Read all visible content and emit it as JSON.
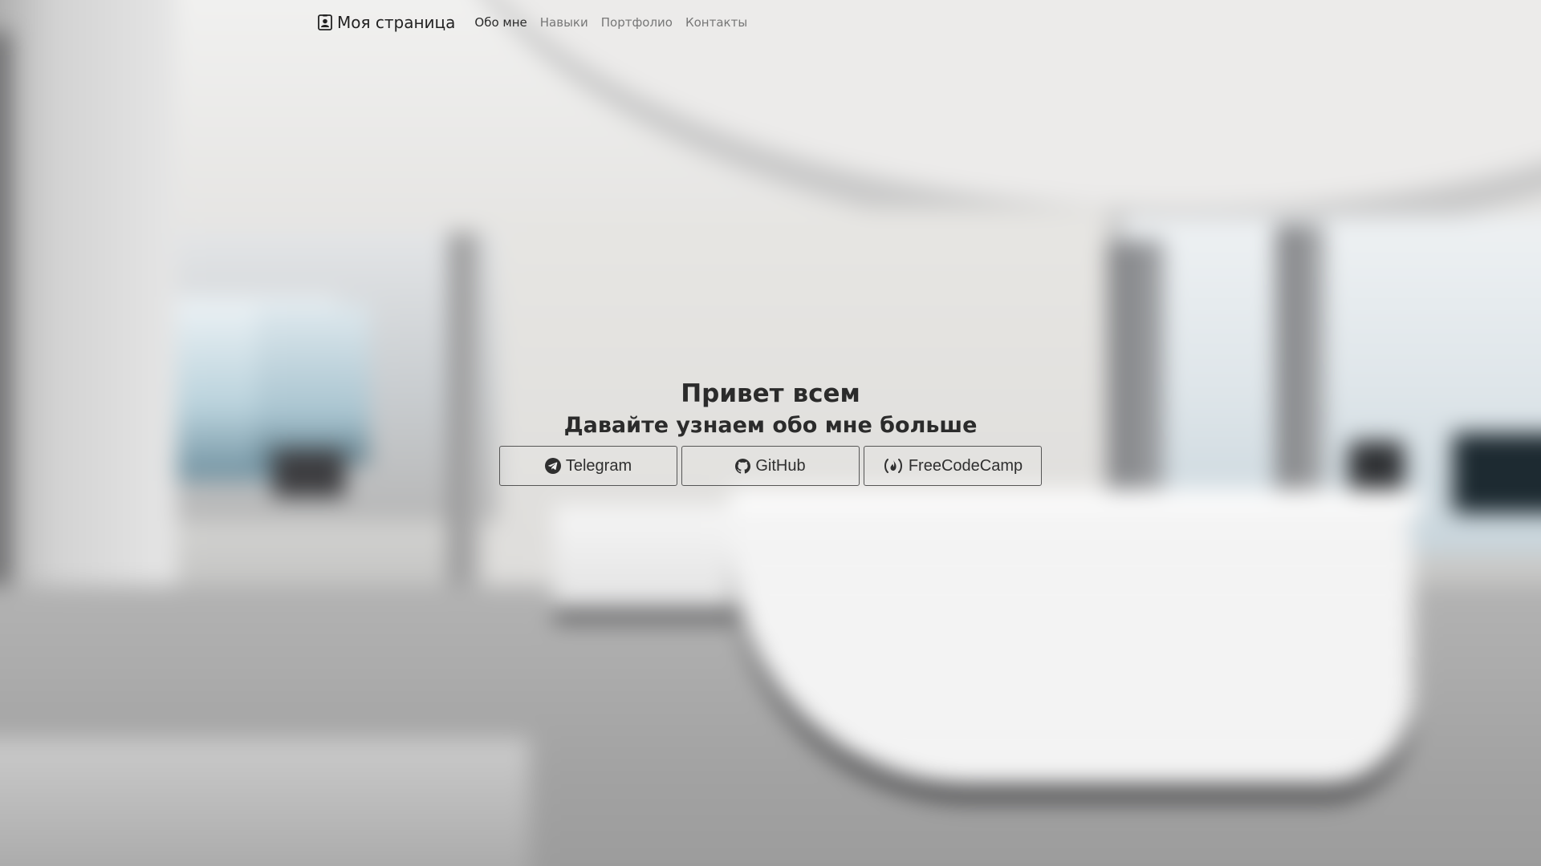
{
  "navbar": {
    "brand_label": "Моя страница",
    "brand_icon": "person-badge-icon",
    "links": [
      {
        "label": "Обо мне",
        "active": true
      },
      {
        "label": "Навыки",
        "active": false
      },
      {
        "label": "Портфолио",
        "active": false
      },
      {
        "label": "Контакты",
        "active": false
      }
    ]
  },
  "hero": {
    "title": "Привет всем",
    "subtitle": "Давайте узнаем обо мне больше",
    "buttons": [
      {
        "label": "Telegram",
        "icon": "telegram-icon"
      },
      {
        "label": "GitHub",
        "icon": "github-icon"
      },
      {
        "label": "FreeCodeCamp",
        "icon": "freecodecamp-icon"
      }
    ]
  },
  "colors": {
    "text_dark": "#2b2b2b",
    "nav_inactive": "#777777",
    "button_border": "#555555"
  }
}
